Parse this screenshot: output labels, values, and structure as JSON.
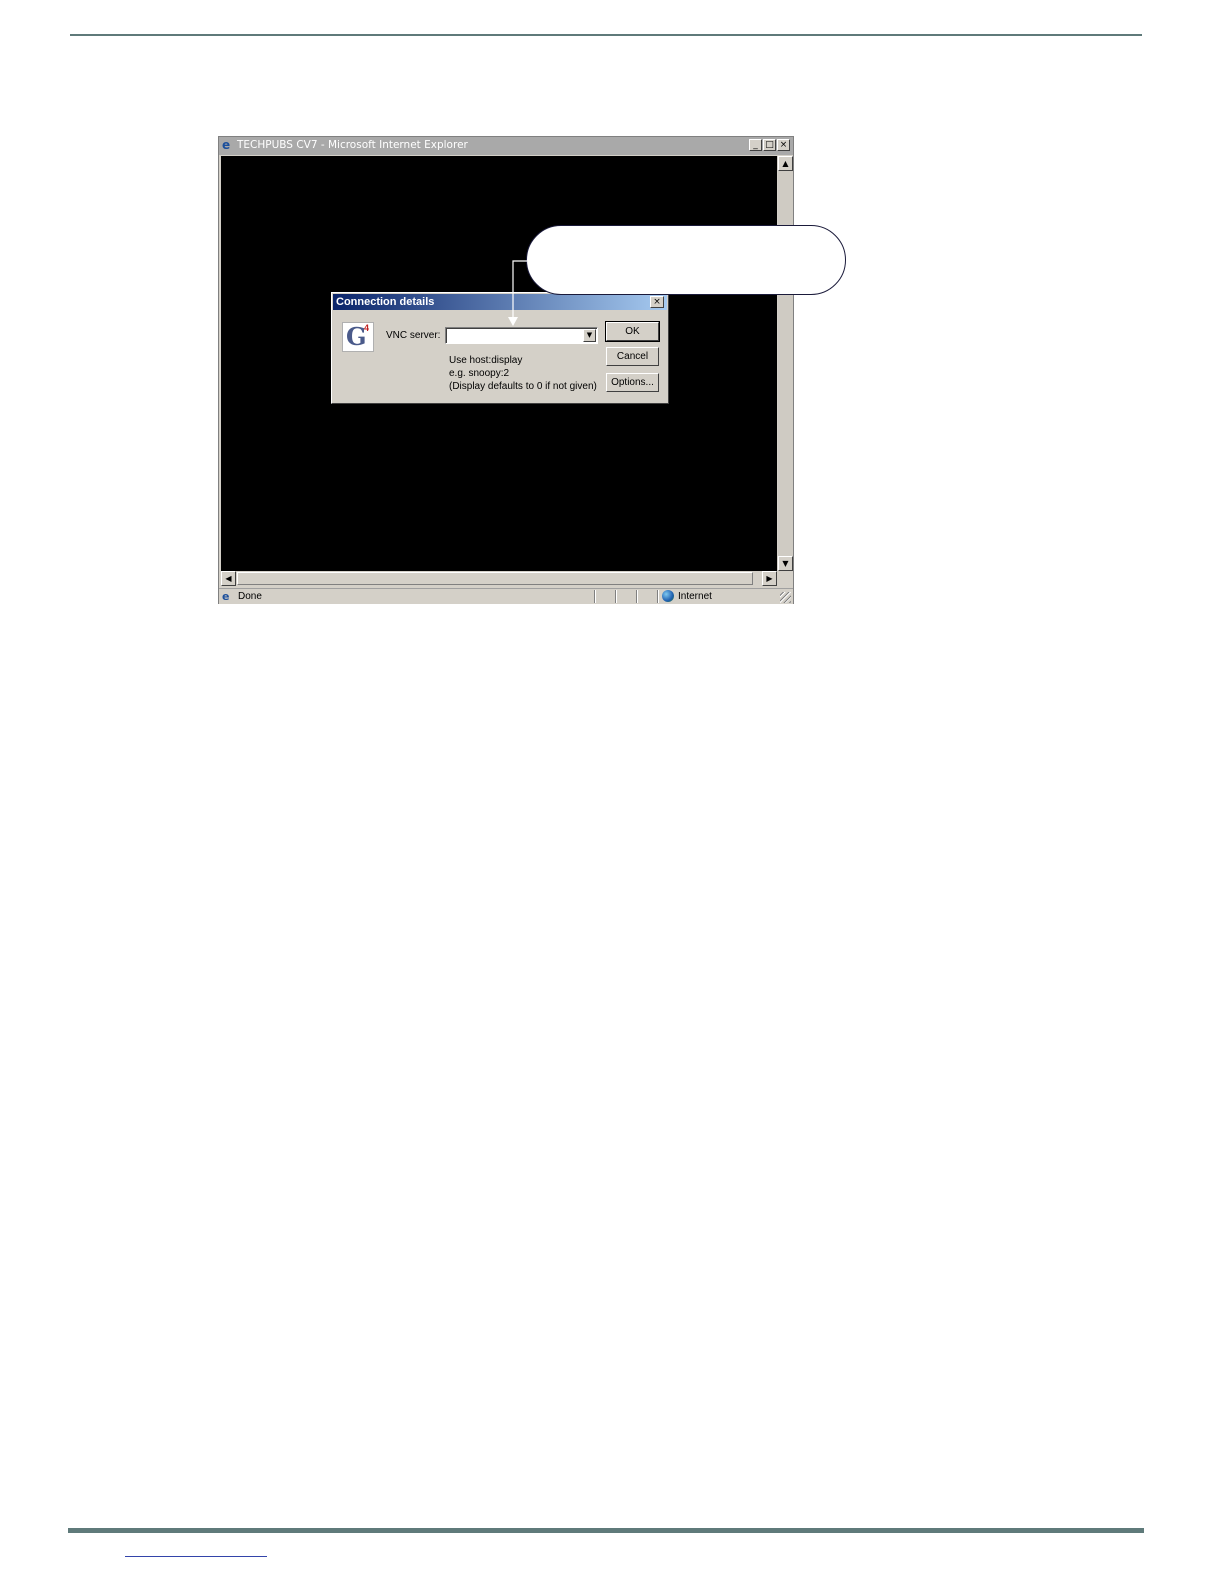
{
  "browser": {
    "title": "TECHPUBS CV7 - Microsoft Internet Explorer",
    "status_text": "Done",
    "zone_text": "Internet",
    "buttons": {
      "minimize": "_",
      "maximize": "□",
      "close": "×"
    }
  },
  "dialog": {
    "title": "Connection details",
    "logo_text": "G",
    "logo_superscript": "4",
    "vnc_server_label": "VNC server:",
    "vnc_server_value": "",
    "hint_lines": [
      "Use host:display",
      "e.g. snoopy:2",
      "(Display defaults to 0 if not given)"
    ],
    "ok_label": "OK",
    "cancel_label": "Cancel",
    "options_label": "Options..."
  },
  "callout": {
    "text": ""
  }
}
